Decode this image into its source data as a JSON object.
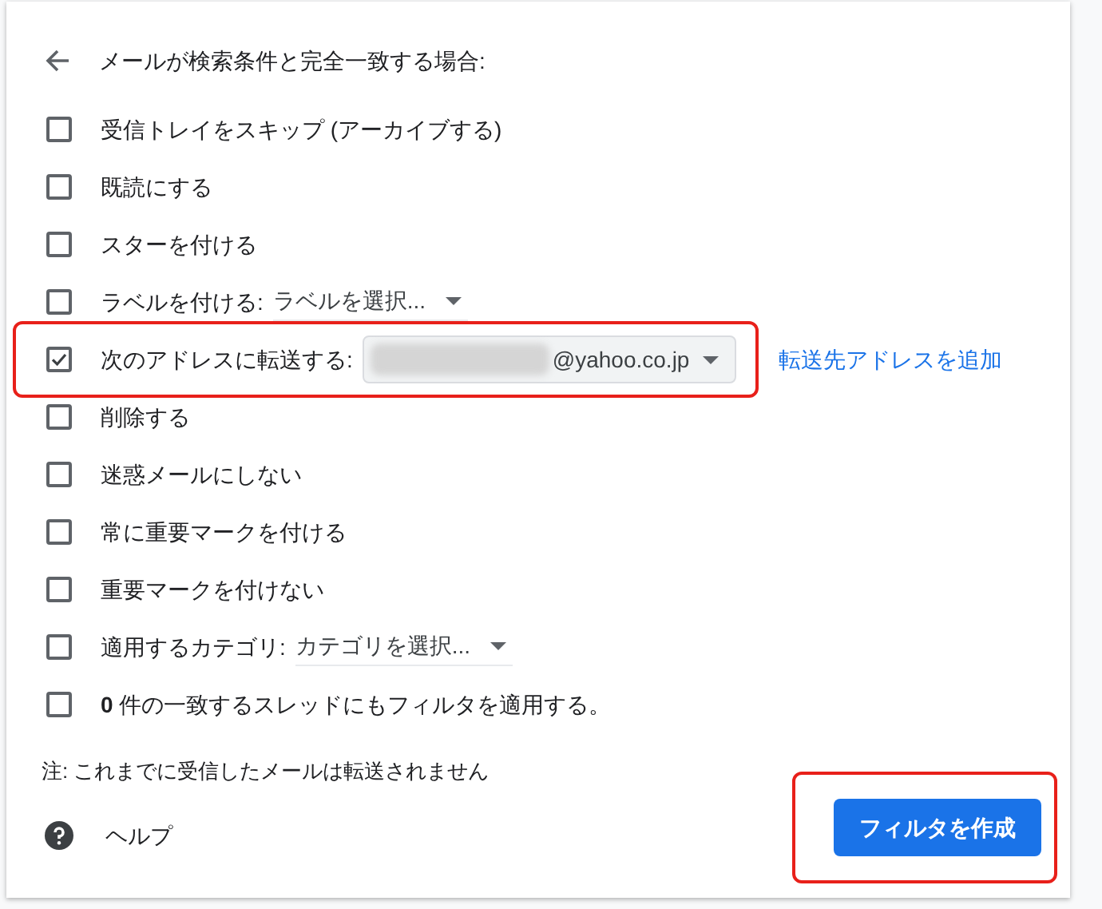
{
  "header": {
    "title": "メールが検索条件と完全一致する場合:"
  },
  "actions": [
    {
      "kind": "plain",
      "label": "受信トレイをスキップ (アーカイブする)",
      "checked": false
    },
    {
      "kind": "plain",
      "label": "既読にする",
      "checked": false
    },
    {
      "kind": "plain",
      "label": "スターを付ける",
      "checked": false
    },
    {
      "kind": "select",
      "label": "ラベルを付ける:",
      "value": "ラベルを選択...",
      "checked": false
    },
    {
      "kind": "forward",
      "label": "次のアドレスに転送する:",
      "value": "@yahoo.co.jp",
      "link": "転送先アドレスを追加",
      "checked": true,
      "highlighted": true
    },
    {
      "kind": "plain",
      "label": "削除する",
      "checked": false
    },
    {
      "kind": "plain",
      "label": "迷惑メールにしない",
      "checked": false
    },
    {
      "kind": "plain",
      "label": "常に重要マークを付ける",
      "checked": false
    },
    {
      "kind": "plain",
      "label": "重要マークを付けない",
      "checked": false
    },
    {
      "kind": "select",
      "label": "適用するカテゴリ:",
      "value": "カテゴリを選択...",
      "checked": false
    },
    {
      "kind": "plain",
      "label": "**0** 件の一致するスレッドにもフィルタを適用する。",
      "checked": false
    }
  ],
  "note": "注: これまでに受信したメールは転送されません",
  "help": "ヘルプ",
  "create_button": {
    "label": "フィルタを作成",
    "highlighted": true
  }
}
